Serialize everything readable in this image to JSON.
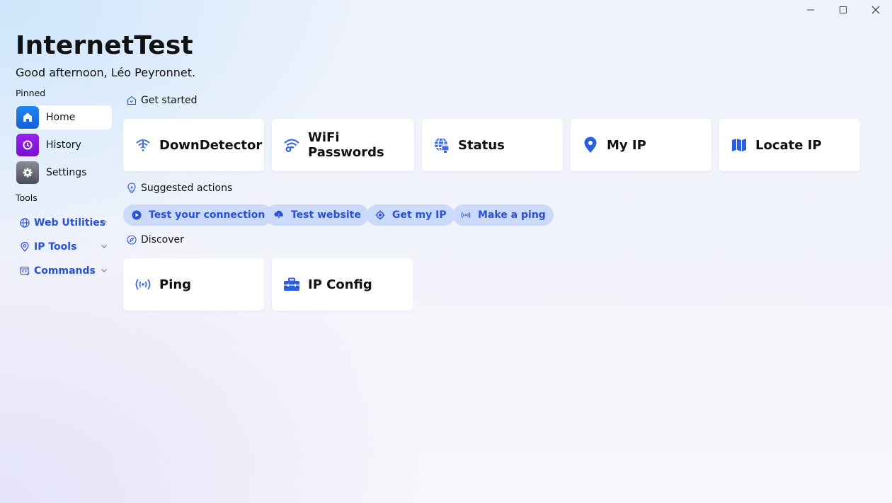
{
  "window": {
    "minimize_icon": "minimize-icon",
    "maximize_icon": "maximize-icon",
    "close_icon": "close-icon"
  },
  "app": {
    "title": "InternetTest",
    "greeting": "Good afternoon, Léo Peyronnet."
  },
  "sidebar": {
    "pinned_label": "Pinned",
    "pinned": [
      {
        "label": "Home",
        "icon": "home-icon",
        "color": "#1a73e8",
        "active": true
      },
      {
        "label": "History",
        "icon": "history-icon",
        "color": "#8a16e0",
        "active": false
      },
      {
        "label": "Settings",
        "icon": "gear-icon",
        "color": "#6b6e78",
        "active": false
      }
    ],
    "tools_label": "Tools",
    "tools": [
      {
        "label": "Web Utilities",
        "icon": "globe-icon"
      },
      {
        "label": "IP Tools",
        "icon": "location-pin-icon"
      },
      {
        "label": "Commands",
        "icon": "code-window-icon"
      }
    ]
  },
  "main": {
    "get_started": {
      "title": "Get started",
      "icon": "home-check-icon",
      "cards": [
        {
          "label": "DownDetector",
          "icon": "wifi-alert-icon"
        },
        {
          "label": "WiFi Passwords",
          "icon": "wifi-lock-icon"
        },
        {
          "label": "Status",
          "icon": "globe-monitor-icon"
        },
        {
          "label": "My IP",
          "icon": "map-pin-icon"
        },
        {
          "label": "Locate IP",
          "icon": "map-icon"
        }
      ]
    },
    "suggested": {
      "title": "Suggested actions",
      "icon": "lightbulb-icon",
      "actions": [
        {
          "label": "Test your connection",
          "icon": "play-icon"
        },
        {
          "label": "Test website",
          "icon": "cloud-download-icon"
        },
        {
          "label": "Get my IP",
          "icon": "target-icon"
        },
        {
          "label": "Make a ping",
          "icon": "broadcast-icon"
        }
      ]
    },
    "discover": {
      "title": "Discover",
      "icon": "compass-icon",
      "cards": [
        {
          "label": "Ping",
          "icon": "broadcast-icon"
        },
        {
          "label": "IP Config",
          "icon": "toolbox-icon"
        }
      ]
    }
  },
  "colors": {
    "accent": "#2752d8",
    "chip_bg": "#cbd9fb"
  }
}
